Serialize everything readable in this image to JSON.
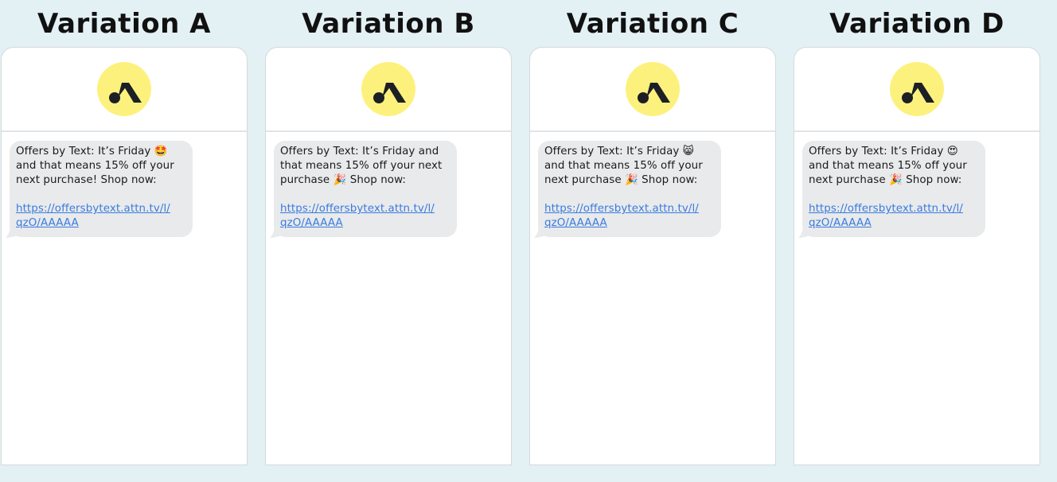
{
  "accent_color": "#fdf17e",
  "link_color": "#3a7be0",
  "bubble_color": "#e8eaeb",
  "avatar_icon": "attentive-logo-icon",
  "variations": [
    {
      "title": "Variation A",
      "message": "Offers by Text: It’s Friday 🤩\nand that means 15% off your\nnext purchase! Shop now:",
      "link": "https://offersbytext.attn.tv/l/\nqzO/AAAAA"
    },
    {
      "title": "Variation B",
      "message": "Offers by Text: It’s Friday and\nthat means 15% off your next\npurchase 🎉 Shop now:",
      "link": "https://offersbytext.attn.tv/l/\nqzO/AAAAA"
    },
    {
      "title": "Variation C",
      "message": "Offers by Text: It’s Friday 😸\nand that means 15% off your\nnext purchase 🎉 Shop now:",
      "link": "https://offersbytext.attn.tv/l/\nqzO/AAAAA"
    },
    {
      "title": "Variation D",
      "message": "Offers by Text: It’s Friday 😍\nand that means 15% off your\nnext purchase 🎉 Shop now:",
      "link": "https://offersbytext.attn.tv/l/\nqzO/AAAAA"
    }
  ]
}
